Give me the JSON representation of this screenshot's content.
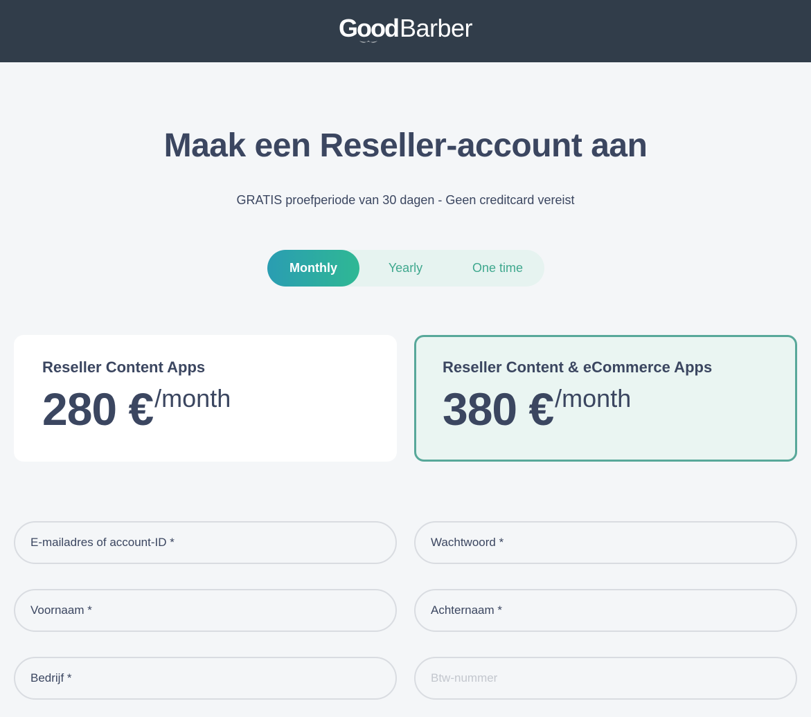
{
  "header": {
    "logo_good": "Good",
    "logo_barber": "Barber"
  },
  "page": {
    "title": "Maak een Reseller-account aan",
    "subtitle": "GRATIS proefperiode van 30 dagen - Geen creditcard vereist"
  },
  "billing_toggle": {
    "options": [
      "Monthly",
      "Yearly",
      "One time"
    ],
    "selected": "Monthly"
  },
  "plans": [
    {
      "name": "Reseller Content Apps",
      "price": "280 €",
      "period": "/month",
      "selected": false
    },
    {
      "name": "Reseller Content & eCommerce Apps",
      "price": "380 €",
      "period": "/month",
      "selected": true
    }
  ],
  "form": {
    "email_label": "E-mailadres of account-ID *",
    "password_label": "Wachtwoord *",
    "firstname_label": "Voornaam *",
    "lastname_label": "Achternaam *",
    "company_label": "Bedrijf *",
    "vat_placeholder": "Btw-nummer"
  },
  "colors": {
    "header_bg": "#313d4a",
    "accent_gradient_start": "#2a9db2",
    "accent_gradient_end": "#2fb894",
    "selected_border": "#58a89a",
    "text_primary": "#3b4660"
  }
}
